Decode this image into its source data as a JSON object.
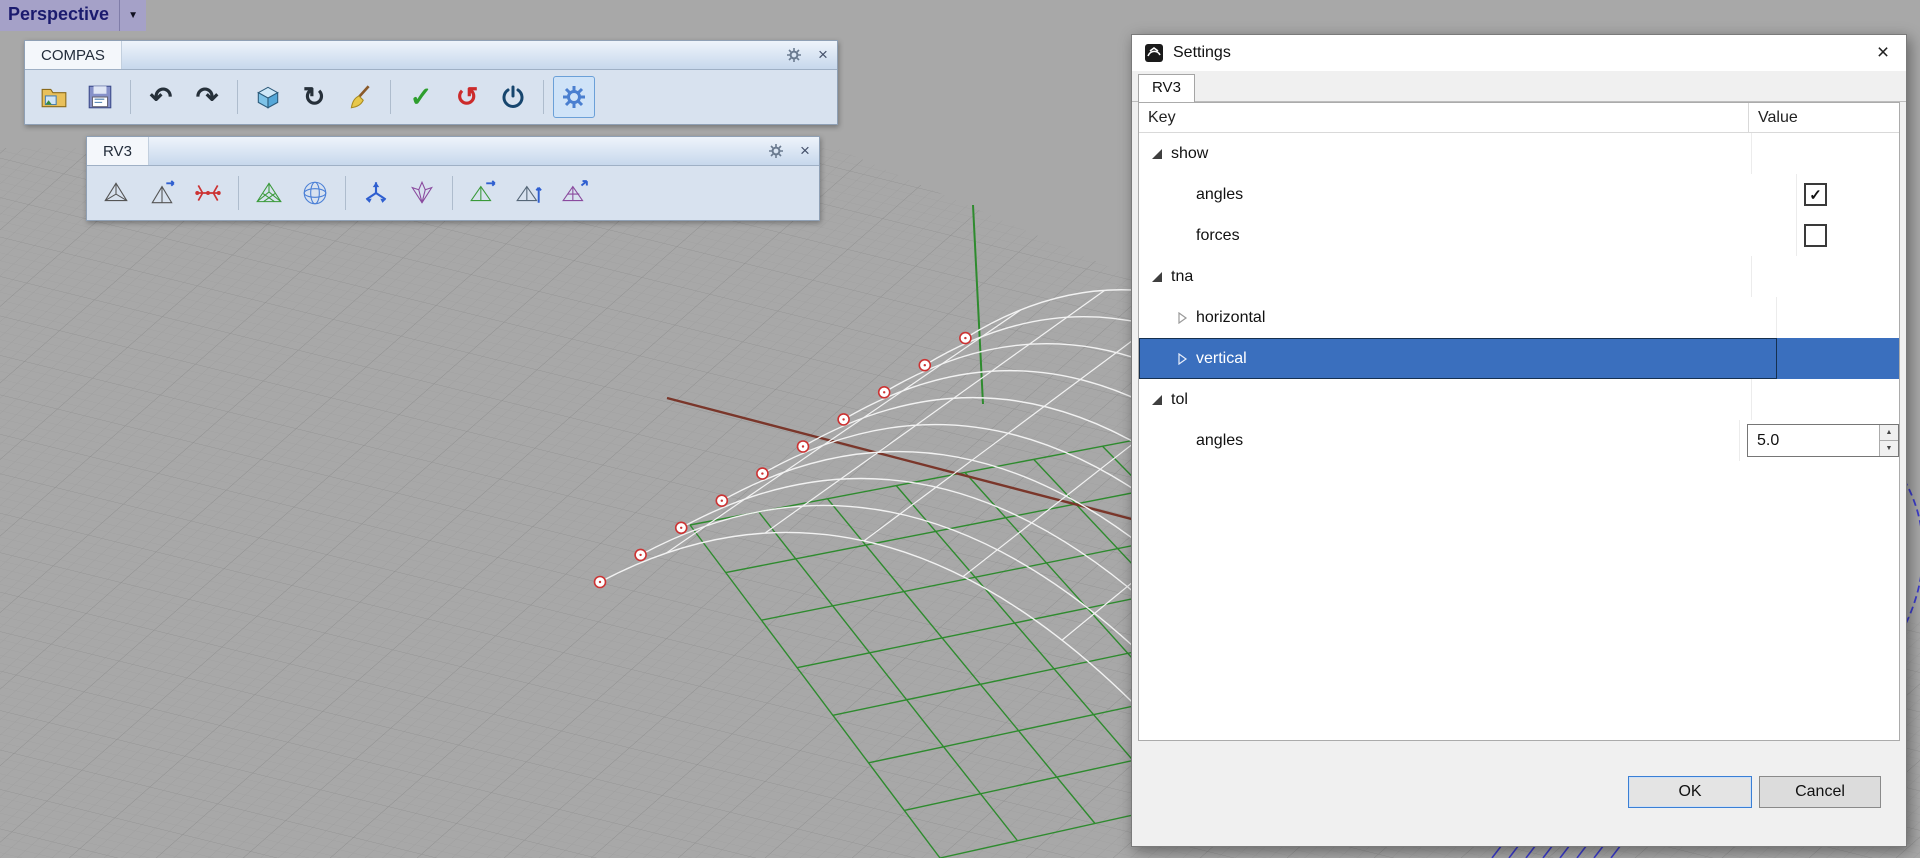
{
  "viewport": {
    "label": "Perspective",
    "background": "#a8a8a8"
  },
  "glyphs": {
    "close": "×",
    "dropdown": "▼",
    "undo": "↶",
    "redo": "↷",
    "refresh": "↻",
    "cloud_sync": "↺",
    "check": "✓",
    "spin_up": "▲",
    "spin_down": "▼"
  },
  "toolbars": {
    "compas": {
      "title": "COMPAS",
      "icons": [
        "open-file",
        "save-file",
        "undo",
        "redo",
        "cube-scene",
        "refresh",
        "clean-broom",
        "verify-check",
        "cloud-sync",
        "power",
        "settings-gears"
      ],
      "active_icon": "settings-gears"
    },
    "rv3": {
      "title": "RV3",
      "icons": [
        "form-diagram",
        "form-diagram-arrow",
        "skeleton",
        "pattern-mesh",
        "force-sphere",
        "equilibrium-arrows",
        "fan-diagram",
        "horizontal-equilibrium",
        "vertical-equilibrium",
        "solve-equilibrium"
      ]
    }
  },
  "dialog": {
    "title": "Settings",
    "tab": "RV3",
    "columns": {
      "key": "Key",
      "value": "Value"
    },
    "rows": [
      {
        "key": "show",
        "type": "group",
        "expanded": true
      },
      {
        "key": "angles",
        "type": "checkbox",
        "checked": true
      },
      {
        "key": "forces",
        "type": "checkbox",
        "checked": false
      },
      {
        "key": "tna",
        "type": "group",
        "expanded": true
      },
      {
        "key": "horizontal",
        "type": "branch",
        "expanded": false
      },
      {
        "key": "vertical",
        "type": "branch",
        "expanded": false,
        "selected": true
      },
      {
        "key": "tol",
        "type": "group",
        "expanded": true
      },
      {
        "key": "angles",
        "type": "number",
        "value": "5.0"
      }
    ],
    "buttons": {
      "ok": "OK",
      "cancel": "Cancel"
    }
  },
  "scene": {
    "colors": {
      "grid": "#9e9e9e",
      "grid_major": "#8f8f8f",
      "mesh": "#f2f2f2",
      "form": "#2e8b2e",
      "line": "#7a362a",
      "vertex": "#cc3333",
      "hatch": "#3c3ccc"
    }
  }
}
